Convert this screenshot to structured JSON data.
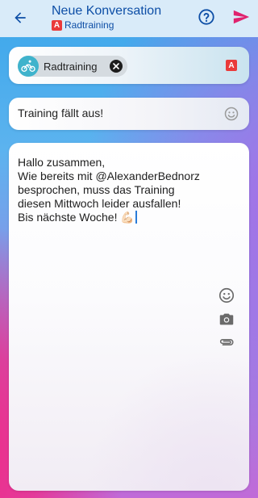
{
  "header": {
    "title": "Neue Konversation",
    "subtitle": "Radtraining",
    "group_badge_letter": "A"
  },
  "recipients": {
    "chip_label": "Radtraining",
    "badge_letter": "A"
  },
  "subject": {
    "value": "Training fällt aus!"
  },
  "message": {
    "lines": [
      "Hallo zusammen,",
      "Wie bereits mit @AlexanderBednorz",
      "besprochen, muss das Training",
      "diesen Mittwoch leider ausfallen!",
      "Bis nächste Woche! 💪🏻"
    ]
  },
  "colors": {
    "accent": "#0d4ea6",
    "send": "#e0226e",
    "badge": "#ea3a3a",
    "chip_avatar": "#3fb3cc"
  },
  "icons": {
    "back": "arrow-left-icon",
    "help": "help-circle-icon",
    "send": "send-icon",
    "avatar": "cyclist-icon",
    "remove": "close-icon",
    "emoji": "smiley-icon",
    "camera": "camera-icon",
    "attach": "paperclip-icon"
  }
}
